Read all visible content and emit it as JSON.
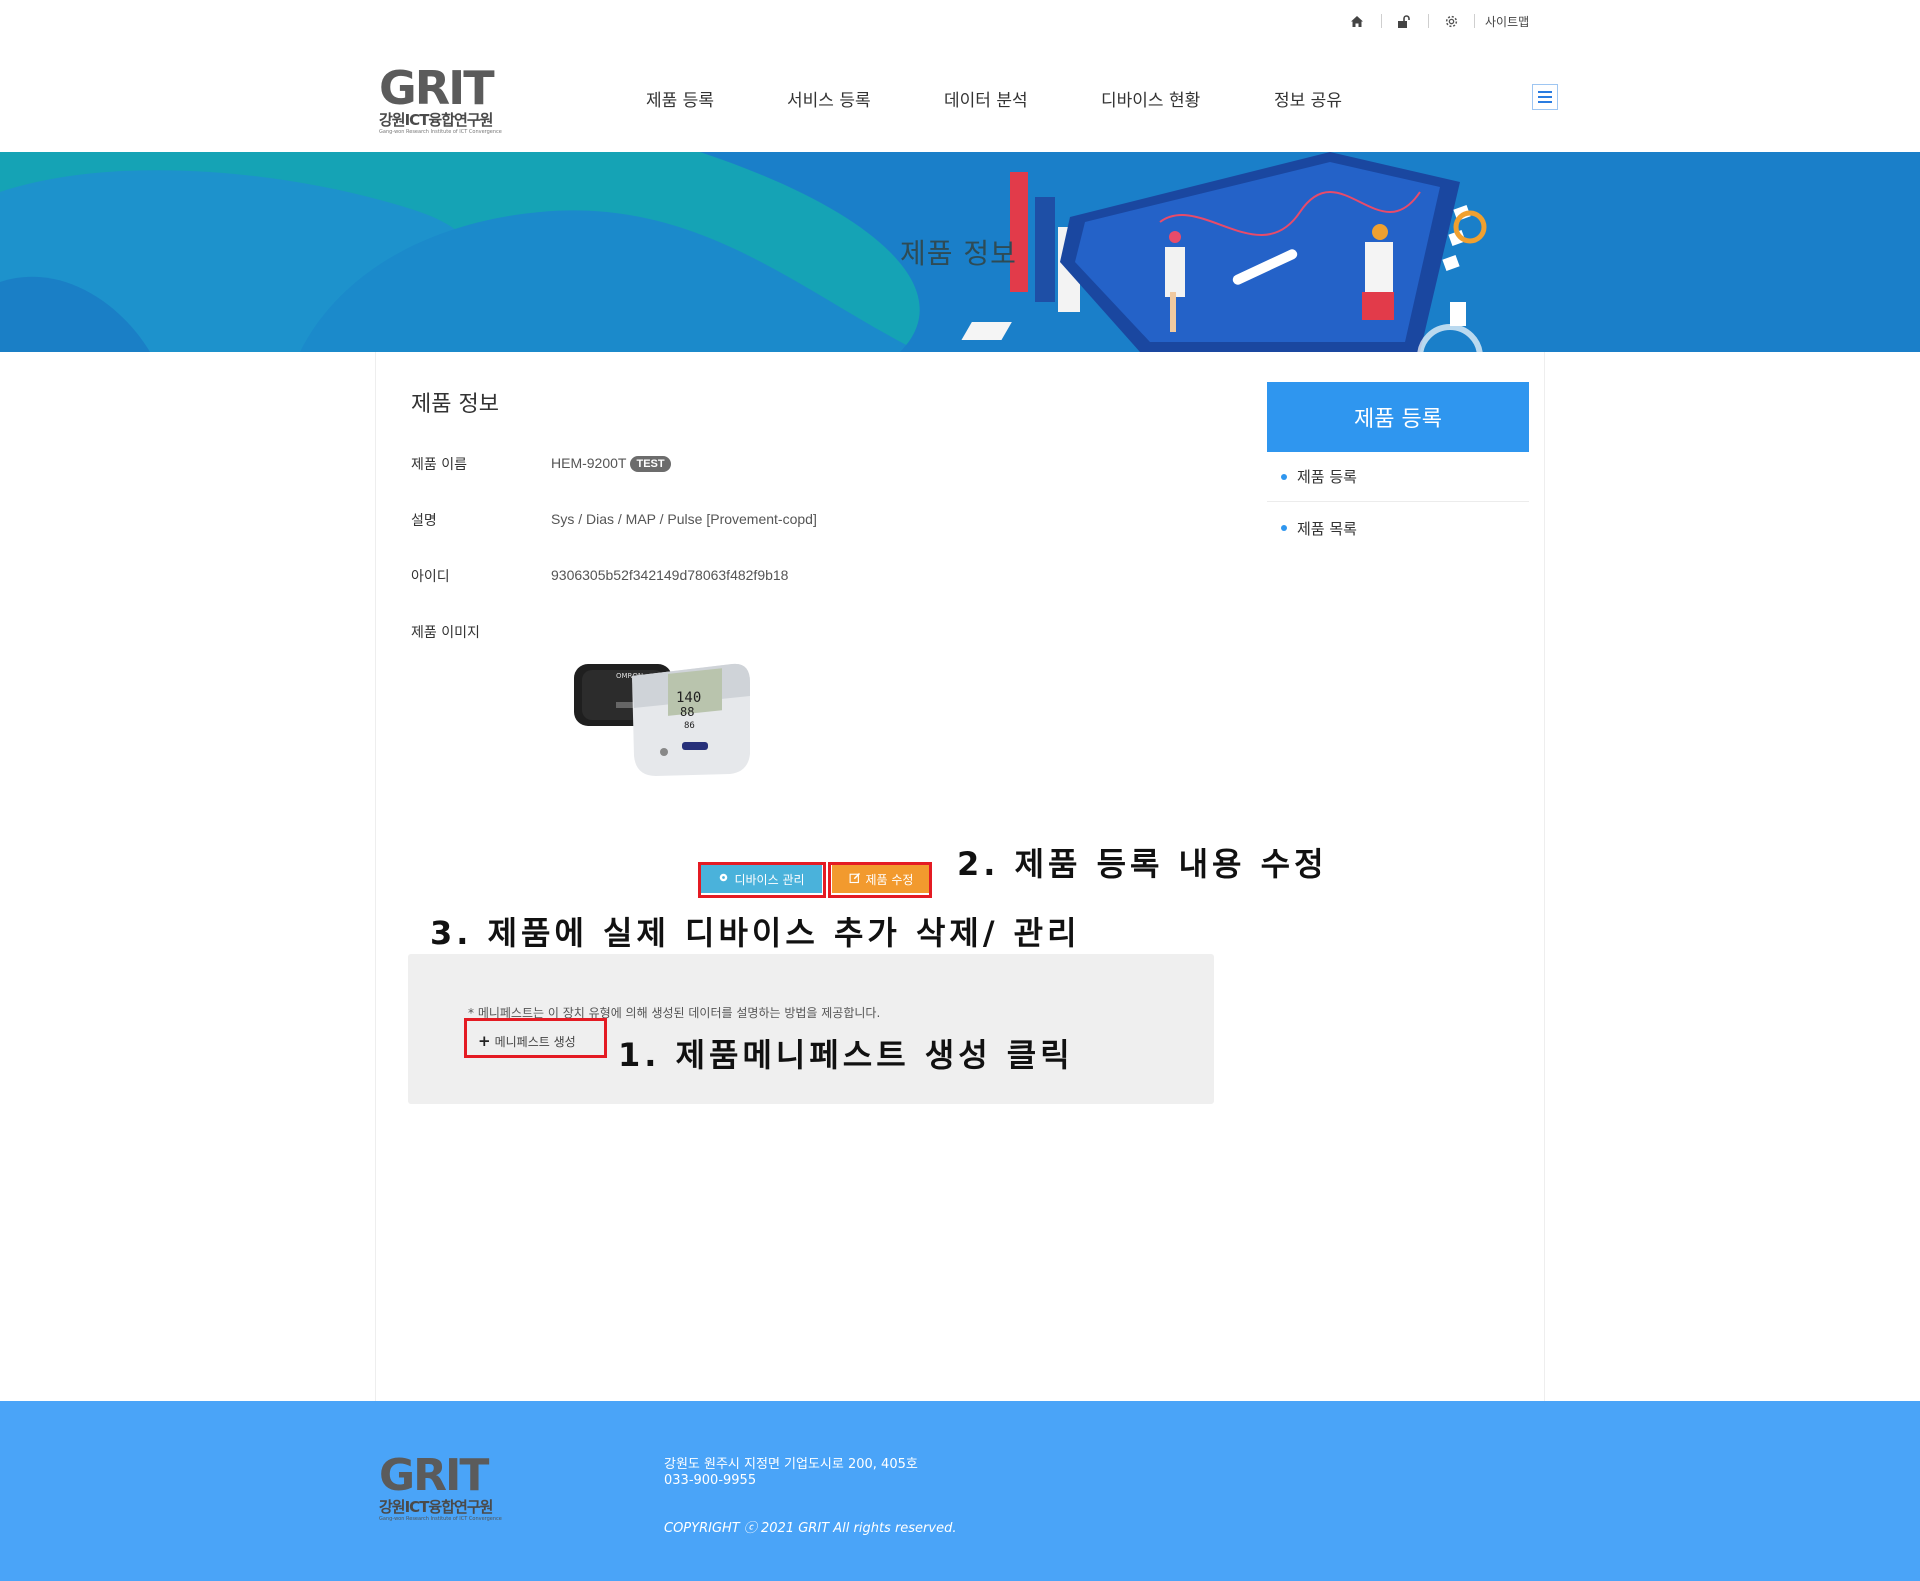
{
  "topbar": {
    "home_icon": "home-icon",
    "lock_icon": "unlock-icon",
    "settings_icon": "gear-icon",
    "sitemap_label": "사이트맵"
  },
  "brand": {
    "grit": "GRIT",
    "korean": "강원ICT융합연구원",
    "english": "Gang-won Research Institute of ICT Convergence"
  },
  "gnb": [
    "제품 등록",
    "서비스 등록",
    "데이터 분석",
    "디바이스 현황",
    "정보 공유"
  ],
  "banner": {
    "title": "제품 정보"
  },
  "main": {
    "title": "제품 정보",
    "rows": [
      {
        "label": "제품 이름",
        "value": "HEM-9200T",
        "badge": "TEST"
      },
      {
        "label": "설명",
        "value": "Sys / Dias / MAP / Pulse [Provement-copd]"
      },
      {
        "label": "아이디",
        "value": "9306305b52f342149d78063f482f9b18"
      },
      {
        "label": "제품 이미지"
      }
    ],
    "device_button": "디바이스 관리",
    "edit_button": "제품 수정",
    "manifest_note": "* 메니페스트는 이 장치 유형에 의해 생성된 데이터를 설명하는 방법을 제공합니다.",
    "manifest_button": "메니페스트 생성"
  },
  "annotations": {
    "step1": "1. 제품메니페스트 생성 클릭",
    "step2": "2. 제품 등록 내용 수정",
    "step3": "3. 제품에 실제 디바이스 추가 삭제/ 관리"
  },
  "sidebar": {
    "title": "제품 등록",
    "items": [
      "제품 등록",
      "제품 목록"
    ]
  },
  "footer": {
    "address": "강원도 원주시 지정면 기업도시로 200, 405호",
    "phone": "033-900-9955",
    "copyright": "COPYRIGHT ⓒ 2021 GRIT All rights reserved."
  },
  "colors": {
    "brand_blue": "#2f96ef",
    "footer_blue": "#4aa4f8",
    "device_btn": "#4ab2db",
    "edit_btn": "#f29a2e",
    "highlight_red": "#e41b23"
  }
}
